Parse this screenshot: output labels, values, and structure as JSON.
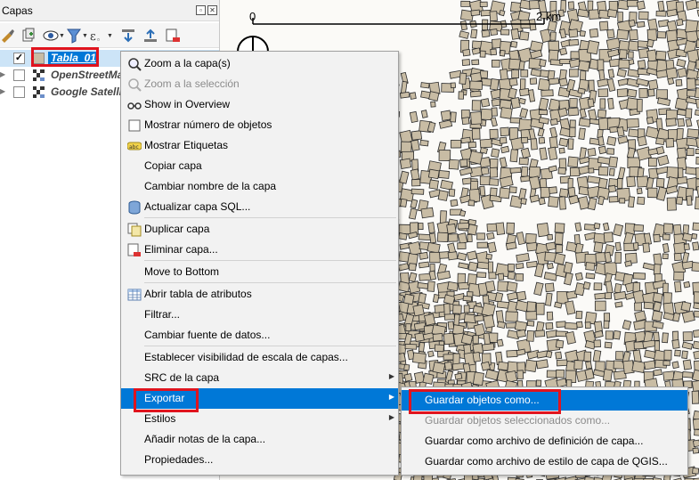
{
  "panel": {
    "title": "Capas",
    "layers": [
      {
        "name": "Tabla_01",
        "checked": true,
        "selected": true
      },
      {
        "name": "OpenStreetMap",
        "checked": false,
        "selected": false
      },
      {
        "name": "Google Satellite",
        "checked": false,
        "selected": false
      }
    ]
  },
  "map": {
    "scalebar_start": "0",
    "scalebar_end": "2 km"
  },
  "context_menu": {
    "items": [
      {
        "label": "Zoom a la capa(s)",
        "icon": "zoom-layer-icon",
        "disabled": false
      },
      {
        "label": "Zoom a la selección",
        "icon": "zoom-selection-icon",
        "disabled": true
      },
      {
        "label": "Show in Overview",
        "icon": "overview-icon",
        "disabled": false
      },
      {
        "label": "Mostrar número de objetos",
        "icon": "checkbox-icon",
        "disabled": false
      },
      {
        "label": "Mostrar Etiquetas",
        "icon": "labels-icon",
        "disabled": false
      },
      {
        "label": "Copiar capa",
        "icon": "",
        "disabled": false
      },
      {
        "label": "Cambiar nombre de la capa",
        "icon": "",
        "disabled": false
      },
      {
        "label": "Actualizar capa SQL...",
        "icon": "database-icon",
        "disabled": false
      },
      {
        "label": "Duplicar capa",
        "icon": "duplicate-icon",
        "disabled": false
      },
      {
        "label": "Eliminar capa...",
        "icon": "remove-layer-icon",
        "disabled": false
      },
      {
        "label": "Move to Bottom",
        "icon": "",
        "disabled": false
      },
      {
        "label": "Abrir tabla de atributos",
        "icon": "table-icon",
        "disabled": false
      },
      {
        "label": "Filtrar...",
        "icon": "",
        "disabled": false
      },
      {
        "label": "Cambiar fuente de datos...",
        "icon": "",
        "disabled": false
      },
      {
        "label": "Establecer visibilidad de escala de capas...",
        "icon": "",
        "disabled": false
      },
      {
        "label": "SRC de la capa",
        "icon": "",
        "disabled": false,
        "submenu": true
      },
      {
        "label": "Exportar",
        "icon": "",
        "disabled": false,
        "submenu": true,
        "active": true
      },
      {
        "label": "Estilos",
        "icon": "",
        "disabled": false,
        "submenu": true
      },
      {
        "label": "Añadir notas de la capa...",
        "icon": "",
        "disabled": false
      },
      {
        "label": "Propiedades...",
        "icon": "",
        "disabled": false
      }
    ]
  },
  "export_submenu": {
    "items": [
      {
        "label": "Guardar objetos como...",
        "disabled": false,
        "active": true
      },
      {
        "label": "Guardar objetos seleccionados como...",
        "disabled": true
      },
      {
        "label": "Guardar como archivo de definición de capa...",
        "disabled": false
      },
      {
        "label": "Guardar como archivo de estilo de capa de QGIS...",
        "disabled": false
      }
    ]
  },
  "colors": {
    "accent": "#0078d7",
    "highlight_box": "#e0141e",
    "building_fill": "#c8bca4",
    "building_stroke": "#2b2b2b"
  }
}
